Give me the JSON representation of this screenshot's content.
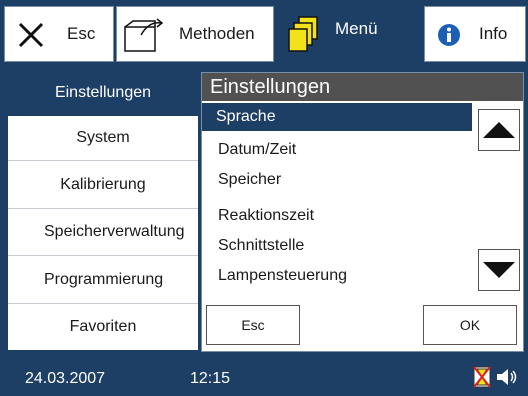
{
  "tabs": {
    "esc": "Esc",
    "methods": "Methoden",
    "menu": "Menü",
    "info": "Info"
  },
  "sidebar": {
    "items": [
      {
        "label": "Einstellungen",
        "active": true
      },
      {
        "label": "System"
      },
      {
        "label": "Kalibrierung"
      },
      {
        "label": "Speicherverwaltung"
      },
      {
        "label": "Programmierung"
      },
      {
        "label": "Favoriten"
      }
    ]
  },
  "dialog": {
    "title": "Einstellungen",
    "items": [
      {
        "label": "Sprache",
        "selected": true
      },
      {
        "label": "Datum/Zeit"
      },
      {
        "label": "Speicher"
      },
      {
        "label": "Reaktionszeit"
      },
      {
        "label": "Schnittstelle"
      },
      {
        "label": "Lampensteuerung"
      }
    ],
    "esc_label": "Esc",
    "ok_label": "OK"
  },
  "status": {
    "date": "24.03.2007",
    "time": "12:15"
  },
  "colors": {
    "accent": "#1d3f66",
    "title_bar": "#515151",
    "folder_yellow": "#f2e21a"
  }
}
